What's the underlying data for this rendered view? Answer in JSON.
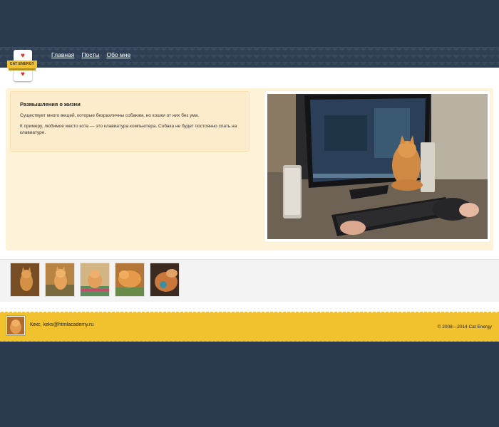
{
  "logo": {
    "text": "CAT ENERGY"
  },
  "nav": {
    "items": [
      {
        "label": "Главная"
      },
      {
        "label": "Посты"
      },
      {
        "label": "Обо мне"
      }
    ]
  },
  "post": {
    "title": "Размышления о жизни",
    "paragraphs": [
      "Существует много вещей, которые безразличны собакам, но кошки от них без ума.",
      "К примеру, любимое место кота — это клавиатура компьютера. Собака не будет постоянно спать на клавиатуре."
    ]
  },
  "gallery": {
    "count": 5
  },
  "footer": {
    "contact": "Кекс, keks@htmlacademy.ru",
    "copyright": "© 2008—2014 Cat Energy"
  },
  "colors": {
    "background": "#2b3a4f",
    "footer": "#f2c22e",
    "feature": "#fef3d9",
    "link": "#ffffff"
  }
}
